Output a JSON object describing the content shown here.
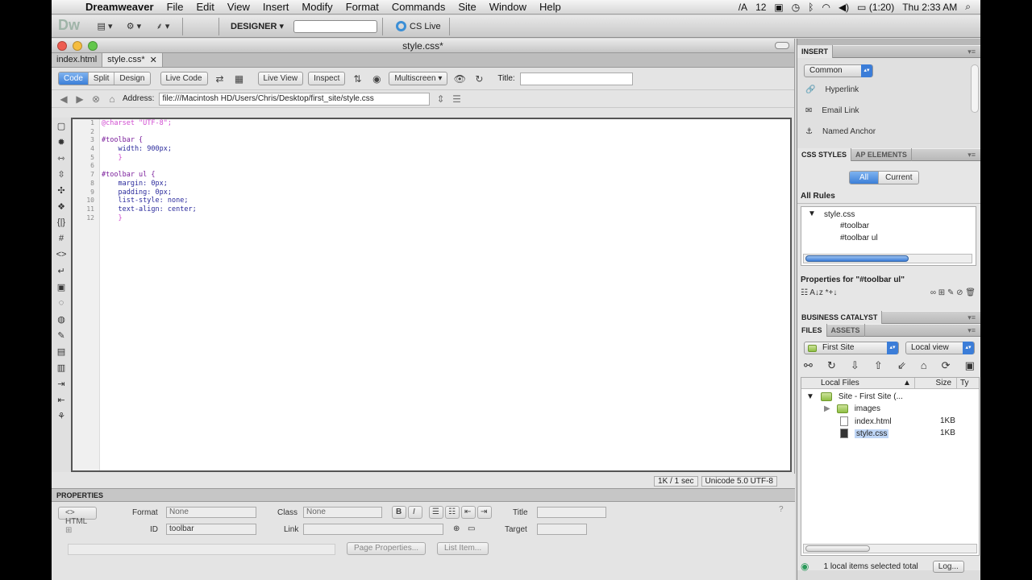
{
  "menubar": {
    "app": "Dreamweaver",
    "items": [
      "File",
      "Edit",
      "View",
      "Insert",
      "Modify",
      "Format",
      "Commands",
      "Site",
      "Window",
      "Help"
    ],
    "status": {
      "input_indicator": "12",
      "battery": "(1:20)",
      "clock": "Thu 2:33 AM"
    }
  },
  "appbar": {
    "logo": "Dw",
    "workspace": "DESIGNER ▾",
    "search_placeholder": "",
    "cslive": "CS Live"
  },
  "document": {
    "window_title": "style.css*",
    "tabs": [
      {
        "label": "index.html",
        "active": false
      },
      {
        "label": "style.css*",
        "active": true
      }
    ],
    "view_buttons": [
      "Code",
      "Split",
      "Design"
    ],
    "live_code": "Live Code",
    "live_view": "Live View",
    "inspect": "Inspect",
    "multiscreen": "Multiscreen",
    "title_label": "Title:",
    "title_value": "",
    "address_label": "Address:",
    "address_value": "file:///Macintosh HD/Users/Chris/Desktop/first_site/style.css",
    "line_numbers": [
      "1",
      "2",
      "3",
      "4",
      "5",
      "6",
      "7",
      "8",
      "9",
      "10",
      "11",
      "12"
    ],
    "code_lines": [
      "@charset \"UTF-8\";",
      "",
      "#toolbar {",
      "    width: 900px;",
      "    }",
      "",
      "#toolbar ul {",
      "    margin: 0px;",
      "    padding: 0px;",
      "    list-style: none;",
      "    text-align: center;",
      "    }"
    ],
    "status_size": "1K / 1 sec",
    "status_encoding": "Unicode 5.0 UTF-8"
  },
  "properties": {
    "header": "PROPERTIES",
    "format_label": "Format",
    "format_value": "None",
    "class_label": "Class",
    "class_value": "None",
    "title_label": "Title",
    "id_label": "ID",
    "id_value": "toolbar",
    "link_label": "Link",
    "target_label": "Target",
    "bold": "B",
    "italic": "I",
    "page_properties": "Page Properties...",
    "list_item": "List Item..."
  },
  "insert_panel": {
    "header": "INSERT",
    "category": "Common",
    "items": [
      "Hyperlink",
      "Email Link",
      "Named Anchor"
    ]
  },
  "css_panel": {
    "tabs": [
      "CSS STYLES",
      "AP ELEMENTS"
    ],
    "mode_buttons": [
      "All",
      "Current"
    ],
    "rules_header": "All Rules",
    "stylesheet": "style.css",
    "rules": [
      "#toolbar",
      "#toolbar ul"
    ],
    "properties_header": "Properties for \"#toolbar ul\""
  },
  "business_catalyst": {
    "header": "BUSINESS CATALYST"
  },
  "files_panel": {
    "tabs": [
      "FILES",
      "ASSETS"
    ],
    "site": "First Site",
    "view": "Local view",
    "columns": [
      "Local Files",
      "Size",
      "Ty"
    ],
    "root": "Site - First Site (...",
    "items": [
      {
        "name": "images",
        "size": "",
        "type": "folder"
      },
      {
        "name": "index.html",
        "size": "1KB",
        "type": "file"
      },
      {
        "name": "style.css",
        "size": "1KB",
        "type": "file"
      }
    ],
    "status": "1 local items selected total",
    "log_button": "Log..."
  }
}
